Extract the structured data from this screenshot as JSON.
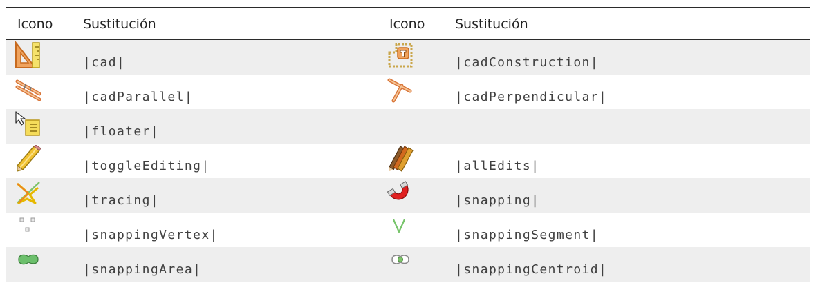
{
  "header": {
    "col1": "Icono",
    "col2": "Sustitución",
    "col3": "Icono",
    "col4": "Sustitución"
  },
  "rows": [
    {
      "left": {
        "icon": "cad-set-square-icon",
        "text": "|cad|"
      },
      "right": {
        "icon": "cad-construction-icon",
        "text": "|cadConstruction|"
      }
    },
    {
      "left": {
        "icon": "cad-parallel-icon",
        "text": "|cadParallel|"
      },
      "right": {
        "icon": "cad-perpendicular-icon",
        "text": "|cadPerpendicular|"
      }
    },
    {
      "left": {
        "icon": "floater-icon",
        "text": "|floater|"
      },
      "right": {
        "icon": "",
        "text": ""
      }
    },
    {
      "left": {
        "icon": "pencil-icon",
        "text": "|toggleEditing|"
      },
      "right": {
        "icon": "all-edits-pencils-icon",
        "text": "|allEdits|"
      }
    },
    {
      "left": {
        "icon": "tracing-icon",
        "text": "|tracing|"
      },
      "right": {
        "icon": "magnet-icon",
        "text": "|snapping|"
      }
    },
    {
      "left": {
        "icon": "snapping-vertex-icon",
        "text": "|snappingVertex|"
      },
      "right": {
        "icon": "snapping-segment-icon",
        "text": "|snappingSegment|"
      }
    },
    {
      "left": {
        "icon": "snapping-area-icon",
        "text": "|snappingArea|"
      },
      "right": {
        "icon": "snapping-centroid-icon",
        "text": "|snappingCentroid|"
      }
    }
  ]
}
